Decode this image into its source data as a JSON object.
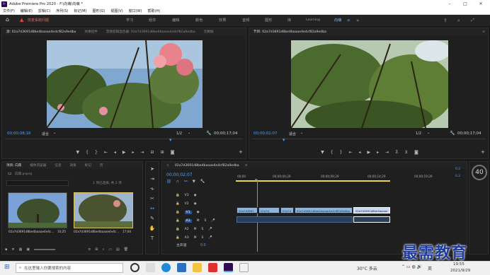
{
  "window": {
    "title": "Adobe Premiere Pro 2020 - F:\\向萌\\向萌 *",
    "app_icon": "Pr"
  },
  "menu": [
    "文件(F)",
    "编辑(E)",
    "剪辑(C)",
    "序列(S)",
    "标记(M)",
    "图形(G)",
    "视图(V)",
    "窗口(W)",
    "帮助(H)"
  ],
  "workspace": {
    "warning": "恢复系统问题",
    "tabs": [
      "学习",
      "组件",
      "编辑",
      "颜色",
      "效果",
      "音频",
      "图形",
      "库",
      "Learning",
      "向萌"
    ],
    "active": "向萌"
  },
  "source_monitor": {
    "tabs": [
      "源: 02a7d3691d8be4baaae4e4cf82a9edba",
      "效果控件",
      "音频剪辑混合器: 02a7d3691d8be4baaae4e4cf82a9edba",
      "元数据"
    ],
    "timecode_in": "00;00;08;16",
    "fit": "适合",
    "res": "1/2",
    "duration": "00;00;17;04"
  },
  "program_monitor": {
    "tab": "节目: 02a7d3691d8be4baaae4e4cf82a9edba",
    "timecode_in": "00;00;02;07",
    "fit": "适合",
    "res": "1/2",
    "duration": "00;00;17;04"
  },
  "project": {
    "tabs": [
      "项目: 向萌",
      "媒体浏览器",
      "信息",
      "效果",
      "标记",
      "历"
    ],
    "path": "向萌.prproj",
    "count": "1 项已选择, 共 2 项",
    "items": [
      {
        "name": "02a7d3691d8be4baaae4e4c...",
        "dur": "10;25"
      },
      {
        "name": "02a7d3691d8be4baaae4e4c...",
        "dur": "17;04"
      }
    ]
  },
  "timeline": {
    "tab": "02a7d3691d8be4baaae4e4cf82a9edba",
    "timecode": "00;00;02;07",
    "ruler": [
      "00;00",
      "00;00;04;29",
      "00;00;09;29",
      "00;00;14;29",
      "00;00;19;29"
    ],
    "tracks": [
      "V3",
      "V2",
      "V1",
      "A1",
      "A2",
      "A3"
    ],
    "master": "主声道",
    "master_val": "0.0",
    "clips": [
      {
        "label": "02a7d3691",
        "color": "#8fb3d9"
      },
      {
        "label": "02a7d",
        "color": "#8fb3d9"
      },
      {
        "label": "02a7d",
        "color": "#8fb3d9"
      },
      {
        "label": "02a7d3691d8be4baaae4e4cf82a9edba",
        "color": "#8fb3d9"
      },
      {
        "label": "02a7d3691d8be4baaae",
        "color": "#c7d7ef"
      }
    ],
    "level_label": "40",
    "level_marks": [
      "0.2",
      "0.2"
    ]
  },
  "taskbar": {
    "search_placeholder": "在这里输入你要搜索的内容",
    "weather": "30°C 多云",
    "time": "19:55",
    "date": "2021/9/29",
    "lang": "英"
  },
  "watermark": "最需教育"
}
